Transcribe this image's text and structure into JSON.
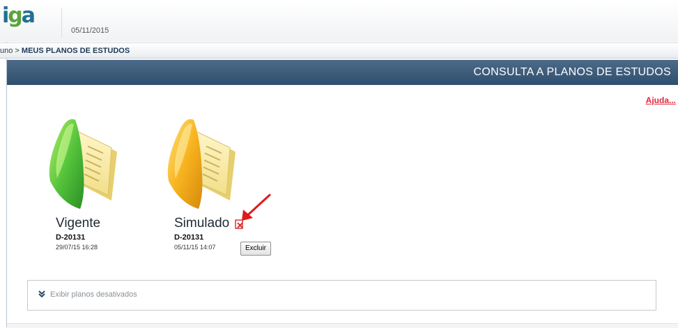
{
  "header": {
    "logo_part1": "i",
    "logo_part2": "g",
    "logo_part3": "a",
    "date": "05/11/2015"
  },
  "breadcrumb": {
    "previous": "uno",
    "separator": ">",
    "current": "MEUS PLANOS DE ESTUDOS"
  },
  "page_title": "CONSULTA A PLANOS DE ESTUDOS",
  "help_link": "Ajuda...",
  "plans": [
    {
      "name": "Vigente",
      "code": "D-20131",
      "datetime": "29/07/15 16:28",
      "folder_color": "green"
    },
    {
      "name": "Simulado",
      "code": "D-20131",
      "datetime": "05/11/15 14:07",
      "folder_color": "orange",
      "delete_label": "Excluir",
      "extra_icon": "pdf-icon"
    }
  ],
  "deactivated_toggle": "Exibir planos desativados",
  "colors": {
    "title_bar": "#3b5a79",
    "help_link": "#e0263b",
    "annotation_arrow": "#e01a1a"
  }
}
